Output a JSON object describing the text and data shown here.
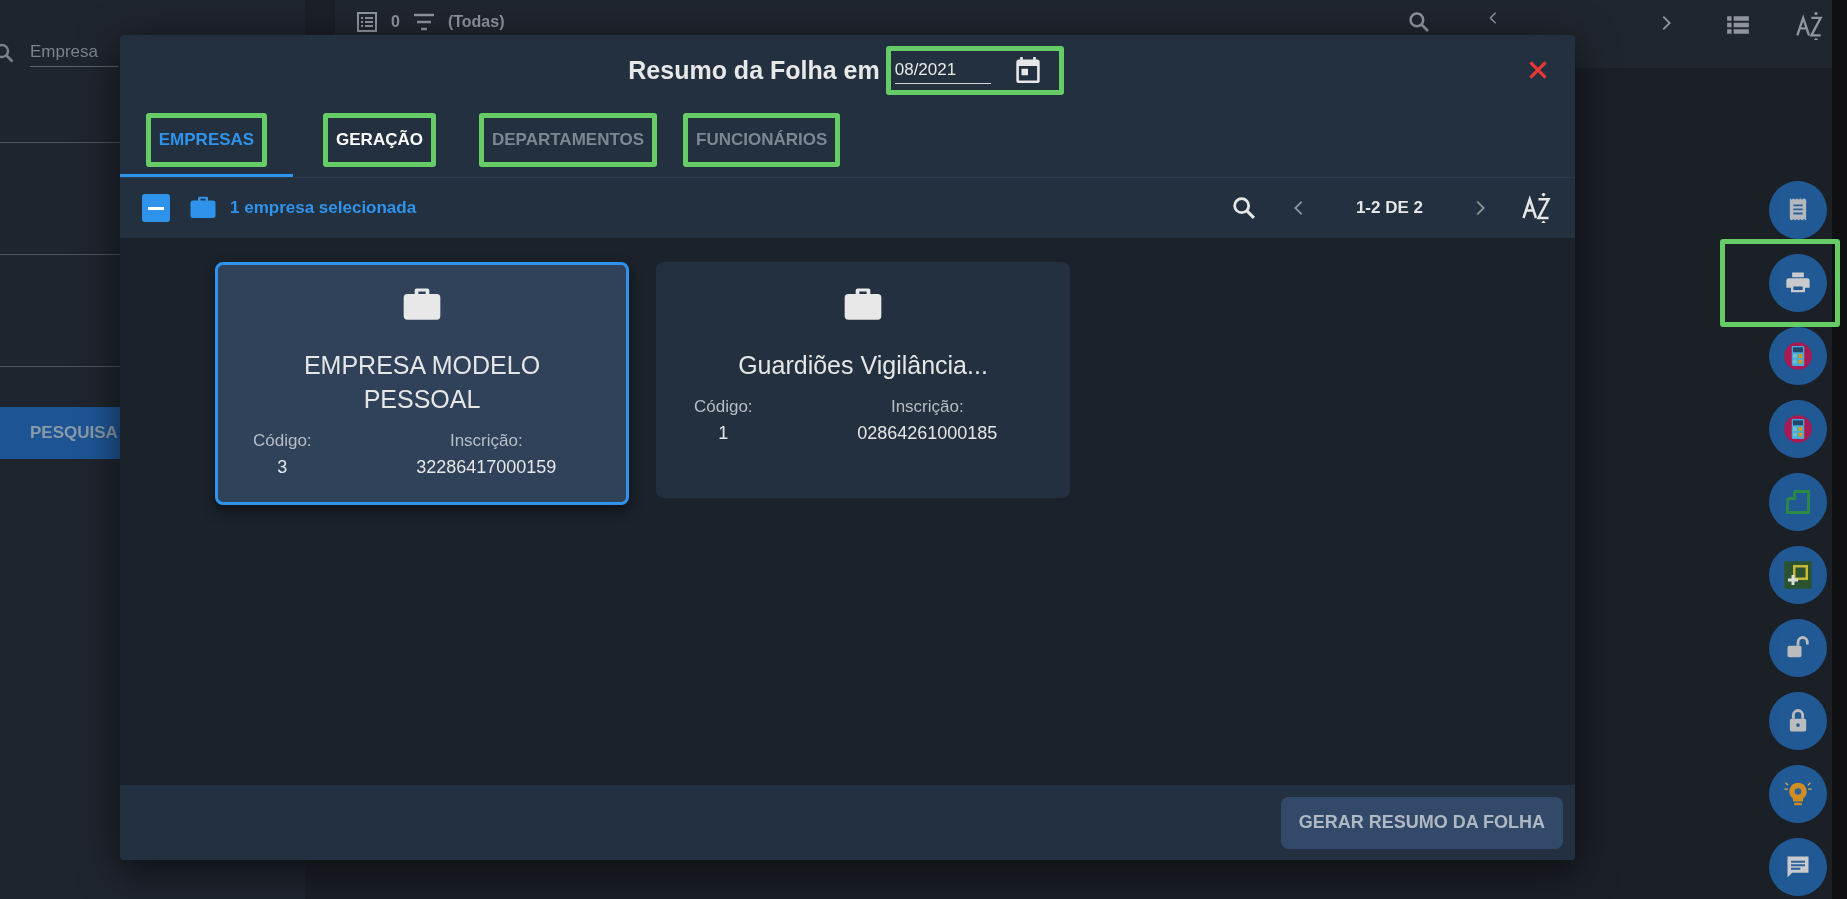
{
  "background": {
    "search": {
      "placeholder": "Empresa"
    },
    "search_button": "PESQUISA",
    "toolbar": {
      "count": "0",
      "filter": "(Todas)"
    }
  },
  "dialog": {
    "title": "Resumo da Folha em",
    "date": {
      "value": "08/2021",
      "highlighted": true
    },
    "tabs": [
      {
        "label": "EMPRESAS",
        "selected": true,
        "disabled": false,
        "highlighted": true
      },
      {
        "label": "GERAÇÃO",
        "selected": false,
        "disabled": false,
        "highlighted": true
      },
      {
        "label": "DEPARTAMENTOS",
        "selected": false,
        "disabled": true,
        "highlighted": true
      },
      {
        "label": "FUNCIONÁRIOS",
        "selected": false,
        "disabled": true,
        "highlighted": true
      }
    ],
    "selection": {
      "indeterminate": true,
      "text": "1 empresa selecionada"
    },
    "pagination": "1-2 DE 2",
    "companies": [
      {
        "name": "EMPRESA MODELO PESSOAL",
        "code_label": "Código:",
        "code": "3",
        "registration_label": "Inscrição:",
        "registration": "32286417000159",
        "selected": true
      },
      {
        "name": "Guardiões Vigilância...",
        "code_label": "Código:",
        "code": "1",
        "registration_label": "Inscrição:",
        "registration": "02864261000185",
        "selected": false
      }
    ],
    "action_button": "GERAR RESUMO DA FOLHA"
  },
  "fab_buttons": [
    {
      "kind": "receipt",
      "highlighted": false
    },
    {
      "kind": "print",
      "highlighted": true
    },
    {
      "kind": "calculator",
      "highlighted": false
    },
    {
      "kind": "calculator",
      "highlighted": false
    },
    {
      "kind": "corner",
      "highlighted": false
    },
    {
      "kind": "add",
      "highlighted": false
    },
    {
      "kind": "unlock",
      "highlighted": false
    },
    {
      "kind": "lock",
      "highlighted": false
    },
    {
      "kind": "bulb",
      "highlighted": false
    },
    {
      "kind": "chat",
      "highlighted": false
    }
  ]
}
